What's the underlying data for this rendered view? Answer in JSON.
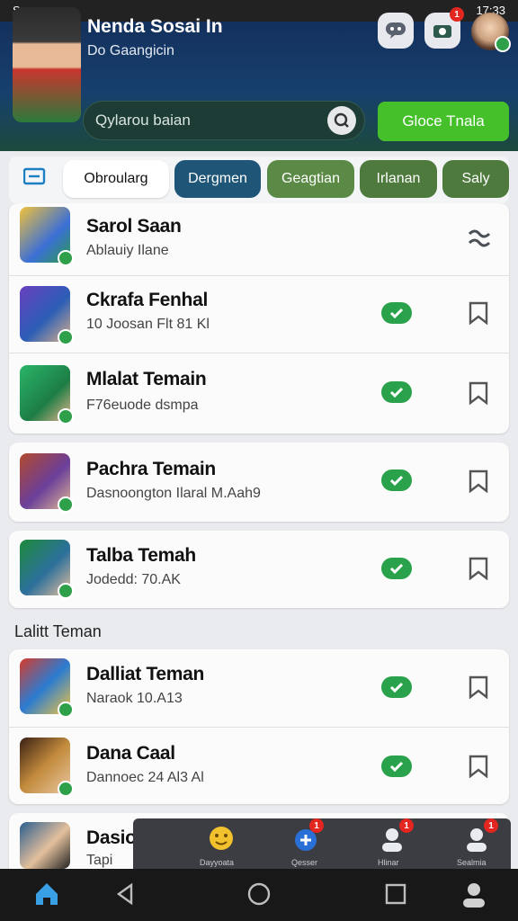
{
  "status_bar": {
    "left": "Smaup",
    "right": "17:33"
  },
  "header": {
    "title": "Nenda Sosai In",
    "subtitle": "Do Gaangicin",
    "search_placeholder": "Qylarou baian",
    "cta_label": "Gloce Tnala",
    "notification_count": "1",
    "icons": [
      "chat-bubble-icon",
      "camera-alert-icon",
      "profile-avatar"
    ]
  },
  "tabs": [
    {
      "label": "Obroularg",
      "active": true,
      "color": "#ffffff"
    },
    {
      "label": "Dergmen",
      "active": false,
      "color": "#1f5577"
    },
    {
      "label": "Geagtian",
      "active": false,
      "color": "#5a8a45"
    },
    {
      "label": "Irlanan",
      "active": false,
      "color": "#4e7a3e"
    },
    {
      "label": "Saly",
      "active": false,
      "color": "#4e7a3e"
    }
  ],
  "friends": [
    {
      "name": "Sarol Saan",
      "meta": "Ablauiy Ilane",
      "action": "swap"
    },
    {
      "name": "Ckrafa Fenhal",
      "meta": "10 Joosan Flt 81 Kl",
      "action": "check"
    },
    {
      "name": "Mlalat Temain",
      "meta": "F76euode dsmpa",
      "action": "check"
    },
    {
      "name": "Pachra Temain",
      "meta": "Dasnoongton Ilaral M.Aah9",
      "action": "check"
    },
    {
      "name": "Talba Temah",
      "meta": "Jodedd: 70.AK",
      "action": "check"
    }
  ],
  "section_title": "Lalitt Teman",
  "section_friends": [
    {
      "name": "Dalliat Teman",
      "meta": "Naraok 10.A13",
      "action": "check"
    },
    {
      "name": "Dana Caal",
      "meta": "Dannoec 24 Al3 Al",
      "action": "check"
    },
    {
      "name": "Dasio Wlan",
      "meta": "Tapi",
      "action": "none"
    }
  ],
  "dock": {
    "items": [
      {
        "label": "Dayyoata",
        "icon": "emoji-icon",
        "badge": ""
      },
      {
        "label": "Qesser",
        "icon": "add-circle-icon",
        "badge": "1"
      },
      {
        "label": "Hlinar",
        "icon": "person-alert-icon",
        "badge": "1"
      },
      {
        "label": "Sealmia",
        "icon": "person-x-icon",
        "badge": "1"
      }
    ]
  },
  "colors": {
    "accent_green": "#2aa24b",
    "header_navy": "#14305c",
    "cta_green": "#45c02b"
  }
}
